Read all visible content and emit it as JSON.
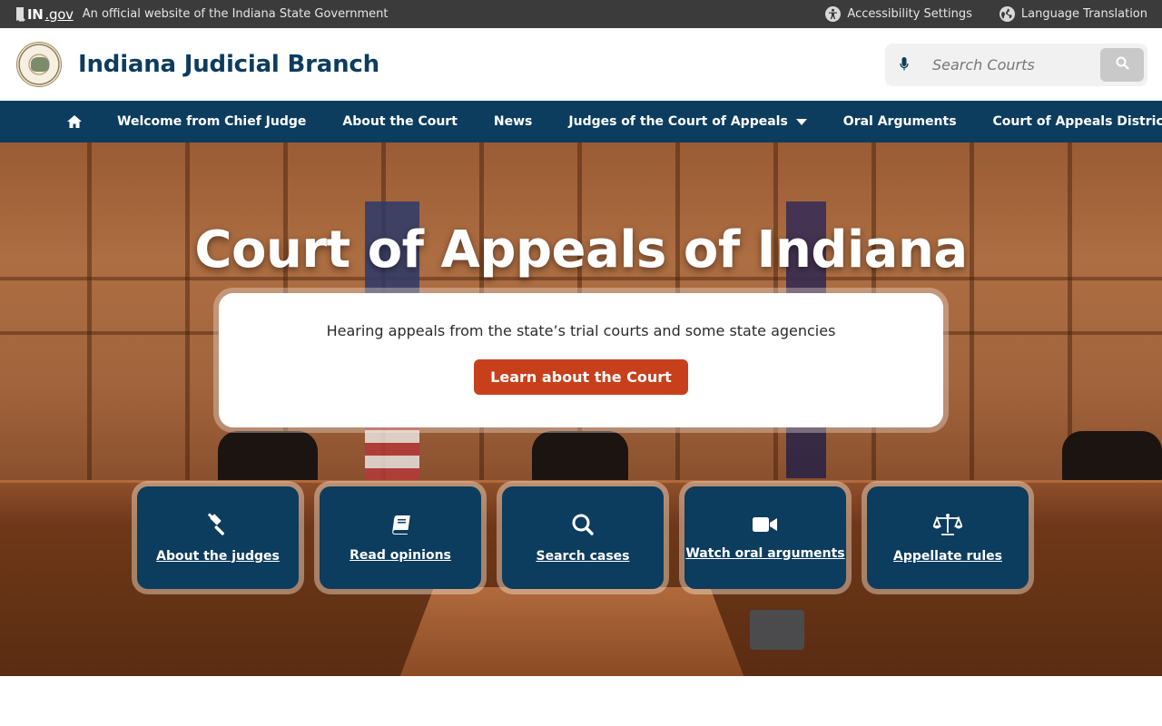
{
  "statebar": {
    "brand_in": "IN",
    "brand_gov": ".gov",
    "official_text": "An official website of the Indiana State Government",
    "accessibility": "Accessibility Settings",
    "language": "Language Translation"
  },
  "header": {
    "title": "Indiana Judicial Branch",
    "search_placeholder": "Search Courts"
  },
  "nav": {
    "items": [
      {
        "label": "Welcome from Chief Judge"
      },
      {
        "label": "About the Court"
      },
      {
        "label": "News"
      },
      {
        "label": "Judges of the Court of Appeals"
      },
      {
        "label": "Oral Arguments"
      },
      {
        "label": "Court of Appeals Districts"
      }
    ]
  },
  "hero": {
    "title": "Court of Appeals of Indiana",
    "subtitle": "Hearing appeals from the state’s trial courts and some state agencies",
    "cta": "Learn about the Court"
  },
  "tiles": [
    {
      "label": "About the judges",
      "icon": "gavel-icon"
    },
    {
      "label": "Read opinions",
      "icon": "book-icon"
    },
    {
      "label": "Search cases",
      "icon": "search-icon"
    },
    {
      "label": "Watch oral arguments",
      "icon": "video-camera-icon"
    },
    {
      "label": "Appellate rules",
      "icon": "scales-icon"
    }
  ],
  "colors": {
    "navy": "#0c3c5e",
    "statebar": "#3b3b3b",
    "cta": "#c8401b"
  }
}
